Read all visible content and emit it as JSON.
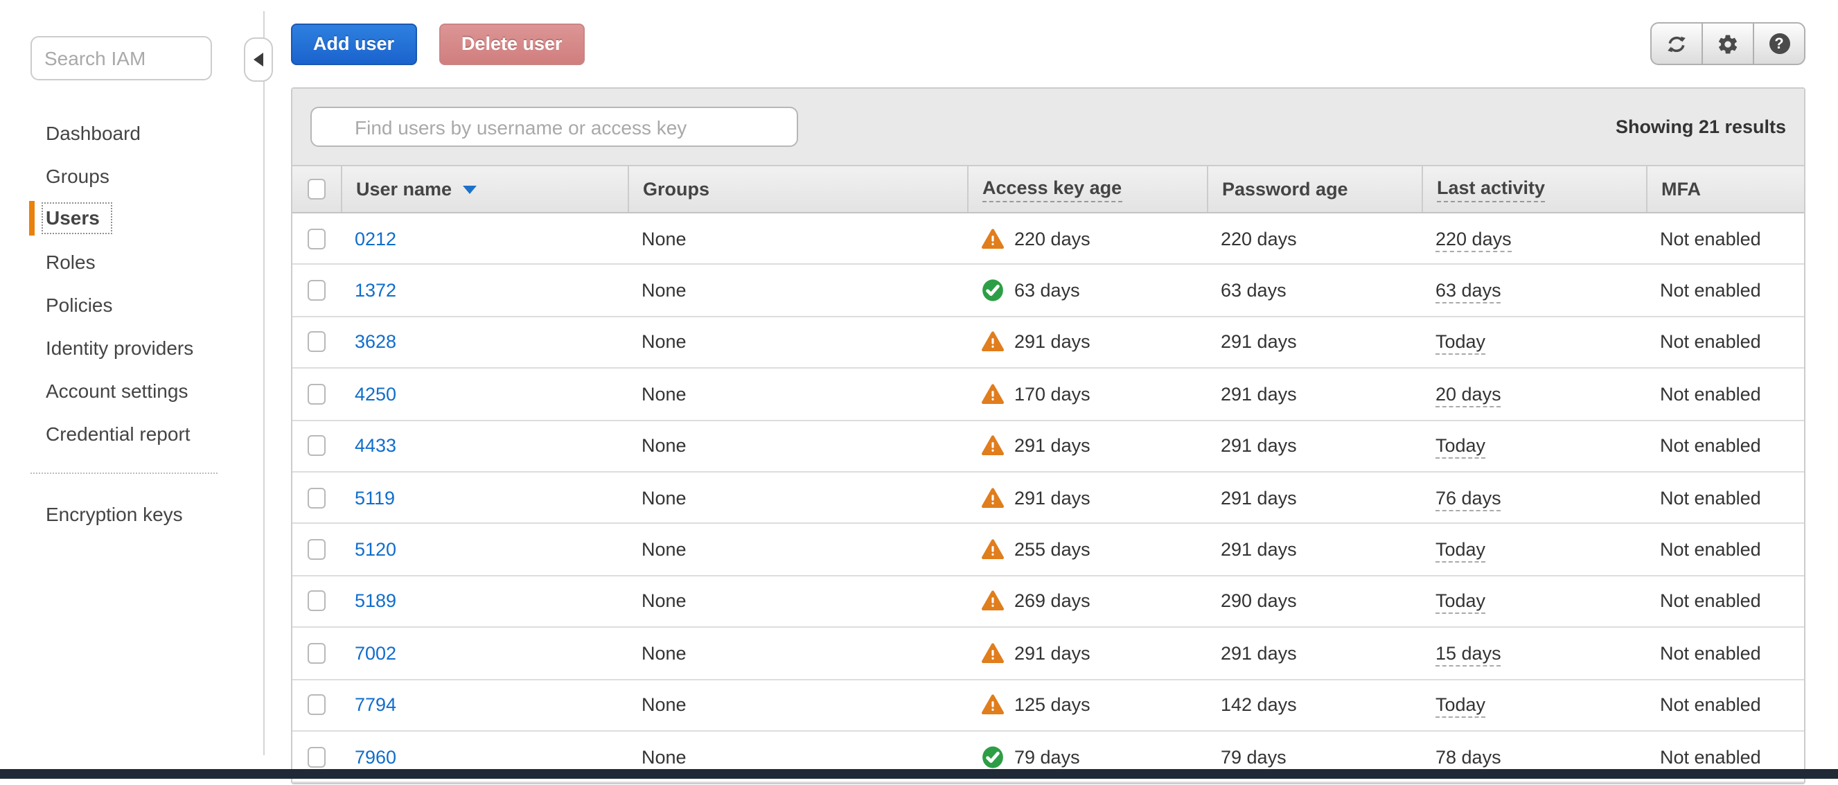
{
  "sidebar": {
    "search_placeholder": "Search IAM",
    "items": [
      {
        "label": "Dashboard",
        "active": false
      },
      {
        "label": "Groups",
        "active": false
      },
      {
        "label": "Users",
        "active": true
      },
      {
        "label": "Roles",
        "active": false
      },
      {
        "label": "Policies",
        "active": false
      },
      {
        "label": "Identity providers",
        "active": false
      },
      {
        "label": "Account settings",
        "active": false
      },
      {
        "label": "Credential report",
        "active": false
      }
    ],
    "secondary_items": [
      {
        "label": "Encryption keys"
      }
    ]
  },
  "toolbar": {
    "add_user_label": "Add user",
    "delete_user_label": "Delete user",
    "icons": [
      "refresh-icon",
      "settings-icon",
      "help-icon"
    ],
    "help_glyph": "?"
  },
  "table": {
    "filter_placeholder": "Find users by username or access key",
    "results_summary": "Showing 21 results",
    "headers": [
      "User name",
      "Groups",
      "Access key age",
      "Password age",
      "Last activity",
      "MFA"
    ],
    "sorted_column": "User name",
    "sort_direction": "descending",
    "rows": [
      {
        "user": "0212",
        "groups": "None",
        "access_key_age": {
          "status": "warning",
          "text": "220 days"
        },
        "password_age": "220 days",
        "last_activity": "220 days",
        "mfa": "Not enabled"
      },
      {
        "user": "1372",
        "groups": "None",
        "access_key_age": {
          "status": "ok",
          "text": "63 days"
        },
        "password_age": "63 days",
        "last_activity": "63 days",
        "mfa": "Not enabled"
      },
      {
        "user": "3628",
        "groups": "None",
        "access_key_age": {
          "status": "warning",
          "text": "291 days"
        },
        "password_age": "291 days",
        "last_activity": "Today",
        "mfa": "Not enabled"
      },
      {
        "user": "4250",
        "groups": "None",
        "access_key_age": {
          "status": "warning",
          "text": "170 days"
        },
        "password_age": "291 days",
        "last_activity": "20 days",
        "mfa": "Not enabled"
      },
      {
        "user": "4433",
        "groups": "None",
        "access_key_age": {
          "status": "warning",
          "text": "291 days"
        },
        "password_age": "291 days",
        "last_activity": "Today",
        "mfa": "Not enabled"
      },
      {
        "user": "5119",
        "groups": "None",
        "access_key_age": {
          "status": "warning",
          "text": "291 days"
        },
        "password_age": "291 days",
        "last_activity": "76 days",
        "mfa": "Not enabled"
      },
      {
        "user": "5120",
        "groups": "None",
        "access_key_age": {
          "status": "warning",
          "text": "255 days"
        },
        "password_age": "291 days",
        "last_activity": "Today",
        "mfa": "Not enabled"
      },
      {
        "user": "5189",
        "groups": "None",
        "access_key_age": {
          "status": "warning",
          "text": "269 days"
        },
        "password_age": "290 days",
        "last_activity": "Today",
        "mfa": "Not enabled"
      },
      {
        "user": "7002",
        "groups": "None",
        "access_key_age": {
          "status": "warning",
          "text": "291 days"
        },
        "password_age": "291 days",
        "last_activity": "15 days",
        "mfa": "Not enabled"
      },
      {
        "user": "7794",
        "groups": "None",
        "access_key_age": {
          "status": "warning",
          "text": "125 days"
        },
        "password_age": "142 days",
        "last_activity": "Today",
        "mfa": "Not enabled"
      },
      {
        "user": "7960",
        "groups": "None",
        "access_key_age": {
          "status": "ok",
          "text": "79 days"
        },
        "password_age": "79 days",
        "last_activity": "78 days",
        "mfa": "Not enabled"
      }
    ]
  },
  "colors": {
    "primary_button_blue": "#1f6dd4",
    "disabled_delete_pink": "#d58888",
    "warning_orange": "#e07d1d",
    "success_green": "#2d9e45",
    "link_blue": "#0f6dcd",
    "active_nav_orange": "#e8820c",
    "footer_navy": "#1f2a36"
  }
}
